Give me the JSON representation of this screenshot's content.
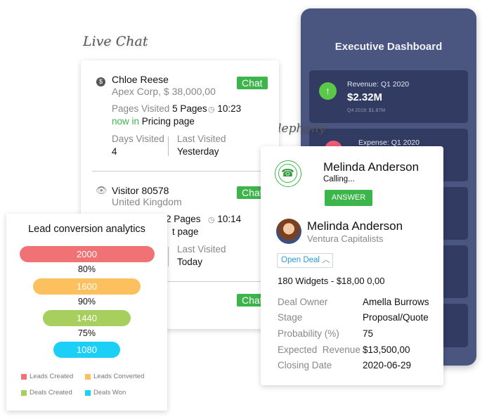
{
  "live_chat": {
    "heading": "Live Chat",
    "visitors": [
      {
        "name": "Chloe Reese",
        "sub": "Apex Corp, $ 38,000,00",
        "chat": "Chat",
        "pages_label": "Pages Visited",
        "pages": "5 Pages",
        "time": "10:23",
        "now_in": "now in",
        "page": "Pricing page",
        "days_label": "Days Visited",
        "days": "4",
        "last_label": "Last Visited",
        "last": "Yesterday",
        "icon": "dollar-icon"
      },
      {
        "name": "Visitor 80578",
        "sub": "United Kingdom",
        "chat": "Chat",
        "pages": "2 Pages",
        "time": "10:14",
        "page": "t page",
        "last_label": "Last Visited",
        "last": "Today",
        "icon": "eye-icon"
      },
      {
        "chat": "Chat"
      }
    ]
  },
  "dashboard": {
    "title": "Executive Dashboard",
    "revenue": {
      "label": "Revenue: Q1 2020",
      "value": "$2.32M",
      "compare": "Q4 2019: $1.87M",
      "color": "#5cc84a"
    },
    "expense": {
      "label": "Expense: Q1 2020",
      "color": "#ef5a78"
    }
  },
  "telephony": {
    "heading": "Telephony",
    "caller": "Melinda Anderson",
    "status": "Calling...",
    "answer": "ANSWER",
    "contact": {
      "name": "Melinda Anderson",
      "company": "Ventura Capitalists"
    },
    "open_deal": "Open Deal",
    "deal": "180 Widgets - $18,00 0,00",
    "fields": [
      {
        "label": "Deal Owner",
        "value": "Amella Burrows"
      },
      {
        "label": "Stage",
        "value": "Proposal/Quote"
      },
      {
        "label": "Probability (%)",
        "value": "75"
      },
      {
        "label": "Expected  Revenue",
        "value": "$13,500,00"
      },
      {
        "label": "Closing Date",
        "value": "2020-06-29"
      }
    ]
  },
  "funnel": {
    "title": "Lead conversion analytics",
    "chart_data": {
      "type": "funnel",
      "values": [
        2000,
        1600,
        1440,
        1080
      ],
      "rates": [
        "80%",
        "90%",
        "75%"
      ],
      "series": [
        {
          "name": "Leads Created",
          "color": "#f07274"
        },
        {
          "name": "Leads Converted",
          "color": "#fdc05e"
        },
        {
          "name": "Deals Created",
          "color": "#a6cf5e"
        },
        {
          "name": "Deals Won",
          "color": "#1ccff7"
        }
      ]
    }
  },
  "accent": "#3cb54a"
}
